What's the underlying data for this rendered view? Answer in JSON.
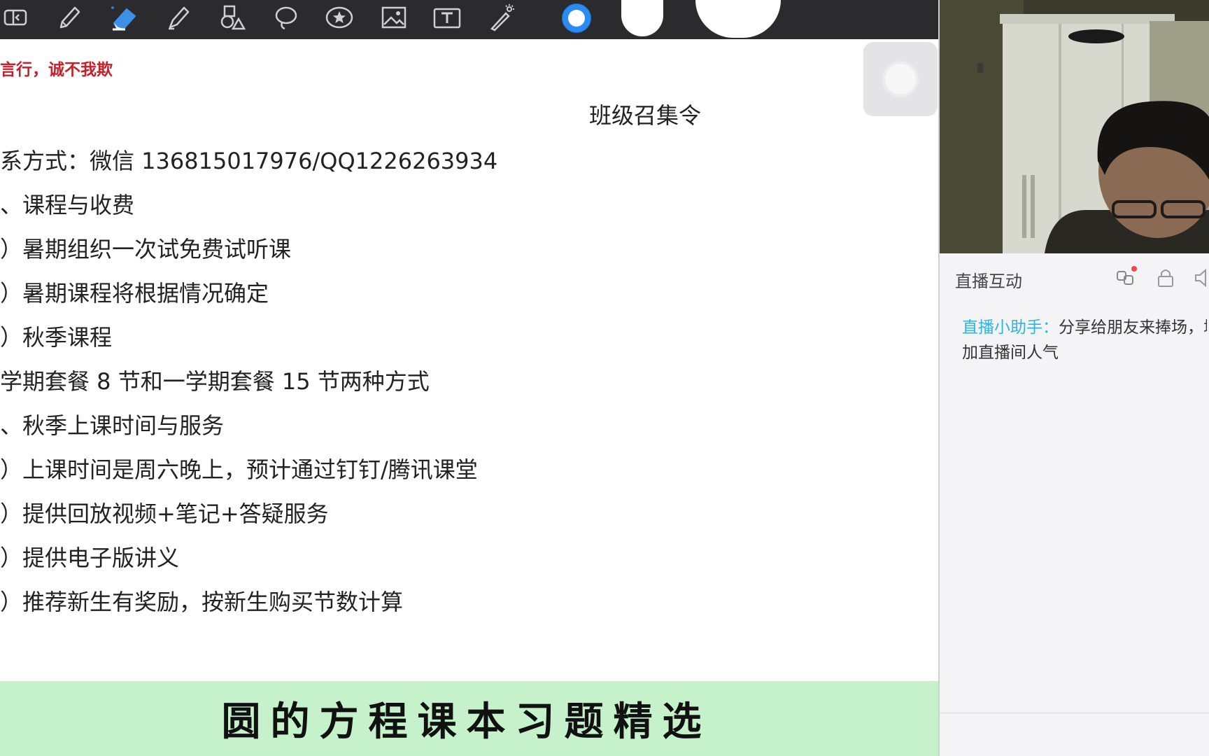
{
  "toolbar": {
    "tools": [
      {
        "icon": "panel-icon",
        "active": false
      },
      {
        "icon": "pen-icon",
        "active": false
      },
      {
        "icon": "eraser-icon",
        "active": true
      },
      {
        "icon": "highlighter-icon",
        "active": false
      },
      {
        "icon": "shapes-icon",
        "active": false
      },
      {
        "icon": "lasso-icon",
        "active": false
      },
      {
        "icon": "sticker-icon",
        "active": false
      },
      {
        "icon": "image-icon",
        "active": false
      },
      {
        "icon": "text-icon",
        "active": false
      },
      {
        "icon": "laser-pointer-icon",
        "active": false
      }
    ],
    "active_color": "#2a8cf0",
    "swatch_color": "#ffffff"
  },
  "document": {
    "motto": "言行，诚不我欺",
    "title": "班级召集令",
    "lines": [
      "系方式：微信 136815017976/QQ1226263934",
      "、课程与收费",
      "）暑期组织一次试免费试听课",
      "）暑期课程将根据情况确定",
      "）秋季课程",
      "学期套餐 8 节和一学期套餐 15 节两种方式",
      "、秋季上课时间与服务",
      "）上课时间是周六晚上，预计通过钉钉/腾讯课堂",
      "）提供回放视频+笔记+答疑服务",
      "）提供电子版讲义",
      "）推荐新生有奖励，按新生购买节数计算"
    ]
  },
  "banner": {
    "text": "圆的方程课本习题精选",
    "bg": "#c6f2cb"
  },
  "live_panel": {
    "title": "直播互动",
    "icons": [
      "share-icon",
      "lock-icon",
      "speaker-icon"
    ],
    "chat": [
      {
        "sender": "直播小助手：",
        "message_line1": "分享给朋友来捧场，增",
        "message_line2": "加直播间人气"
      }
    ],
    "sender_color": "#2bb5e0"
  }
}
